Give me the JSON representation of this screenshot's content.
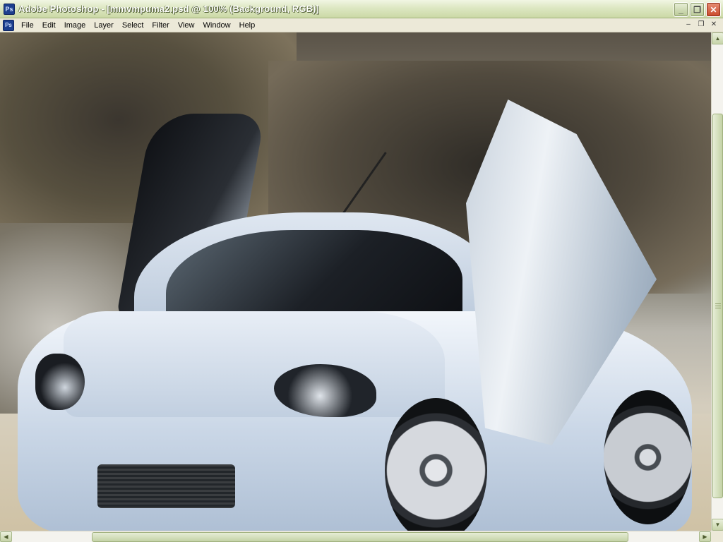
{
  "window": {
    "title": "Adobe Photoshop - [mmvmpuma2.psd @ 100% (Background, RGB)]",
    "app_icon": "photoshop-icon",
    "buttons": {
      "minimize": "_",
      "restore": "❐",
      "close": "✕"
    }
  },
  "menubar": {
    "items": [
      {
        "label": "File"
      },
      {
        "label": "Edit"
      },
      {
        "label": "Image"
      },
      {
        "label": "Layer"
      },
      {
        "label": "Select"
      },
      {
        "label": "Filter"
      },
      {
        "label": "View"
      },
      {
        "label": "Window"
      },
      {
        "label": "Help"
      }
    ],
    "doc_buttons": {
      "minimize": "–",
      "restore": "❐",
      "close": "✕"
    }
  },
  "canvas": {
    "image_subject": "silver-tuned-car-with-lambo-doors"
  },
  "scrollbars": {
    "vertical": {
      "up": "▲",
      "down": "▼"
    },
    "horizontal": {
      "left": "◀",
      "right": "▶"
    }
  }
}
